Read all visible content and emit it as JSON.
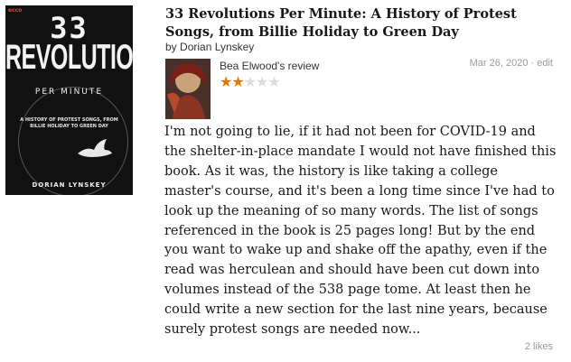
{
  "book": {
    "title": "33 Revolutions Per Minute: A History of Protest Songs, from Billie Holiday to Green Day",
    "by_prefix": "by",
    "author": "Dorian Lynskey",
    "cover": {
      "publisher": "ecco",
      "number": "33",
      "word1": "REVOLUTIONS",
      "word2": "PER MINUTE",
      "subtitle": "A HISTORY OF PROTEST SONGS, FROM BILLIE HOLIDAY TO GREEN DAY",
      "author": "DORIAN LYNSKEY"
    }
  },
  "review": {
    "reviewer": "Bea Elwood",
    "reviewer_suffix": "'s review",
    "rating": 2,
    "max_rating": 5,
    "date": "Mar 26, 2020",
    "separator": "·",
    "edit_label": "edit",
    "text": "I'm not going to lie, if it had not been for COVID-19 and the shelter-in-place mandate I would not have finished this book. As it was, the history is like taking a college master's course, and it's been a long time since I've had to look up the meaning of so many words. The list of songs referenced in the book is 25 pages long! But by the end you want to wake up and shake off the apathy, even if the read was herculean and should have been cut down into volumes instead of the 538 page tome. At least then he could write a new section for the last nine years, because surely protest songs are needed now...",
    "likes": "2 likes"
  },
  "colors": {
    "star_on": "#e87400",
    "star_off": "#dddddd",
    "meta_gray": "#999999",
    "cover_bg": "#111111"
  }
}
